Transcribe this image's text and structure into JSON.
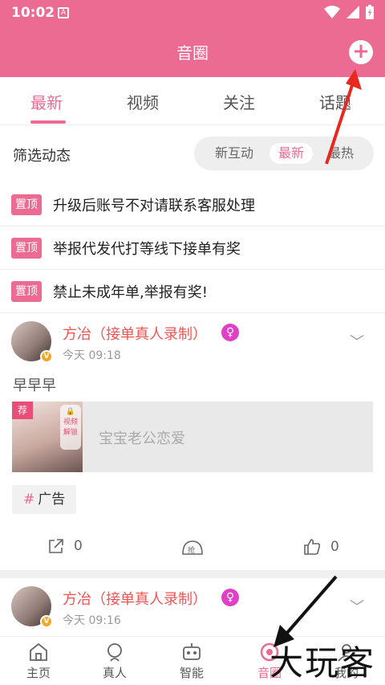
{
  "status": {
    "time": "10:02",
    "notif_letter": "A"
  },
  "header": {
    "title": "音圈"
  },
  "tabs": [
    "最新",
    "视频",
    "关注",
    "话题"
  ],
  "filter": {
    "label": "筛选动态",
    "options": [
      "新互动",
      "最新",
      "最热"
    ],
    "selected": "最新"
  },
  "pinned": {
    "tag": "置顶",
    "items": [
      "升级后账号不对请联系客服处理",
      "举报代发代打等线下接单有奖",
      "禁止未成年单,举报有奖!"
    ]
  },
  "posts": [
    {
      "name": "方冶（接单真人录制）",
      "time": "今天 09:18",
      "text": "早早早",
      "media_badge": "荐",
      "media_lock": "视频解锁",
      "media_title": "宝宝老公恋爱",
      "tag": "广告",
      "share_count": "0",
      "like_count": "0"
    },
    {
      "name": "方冶（接单真人录制）",
      "time": "今天 09:16"
    }
  ],
  "bottom_nav": [
    "主页",
    "真人",
    "智能",
    "音圈",
    "我的"
  ],
  "watermark": "大玩客",
  "colors": {
    "accent": "#ec6b92",
    "username": "#f05454",
    "gender": "#e040c8"
  }
}
